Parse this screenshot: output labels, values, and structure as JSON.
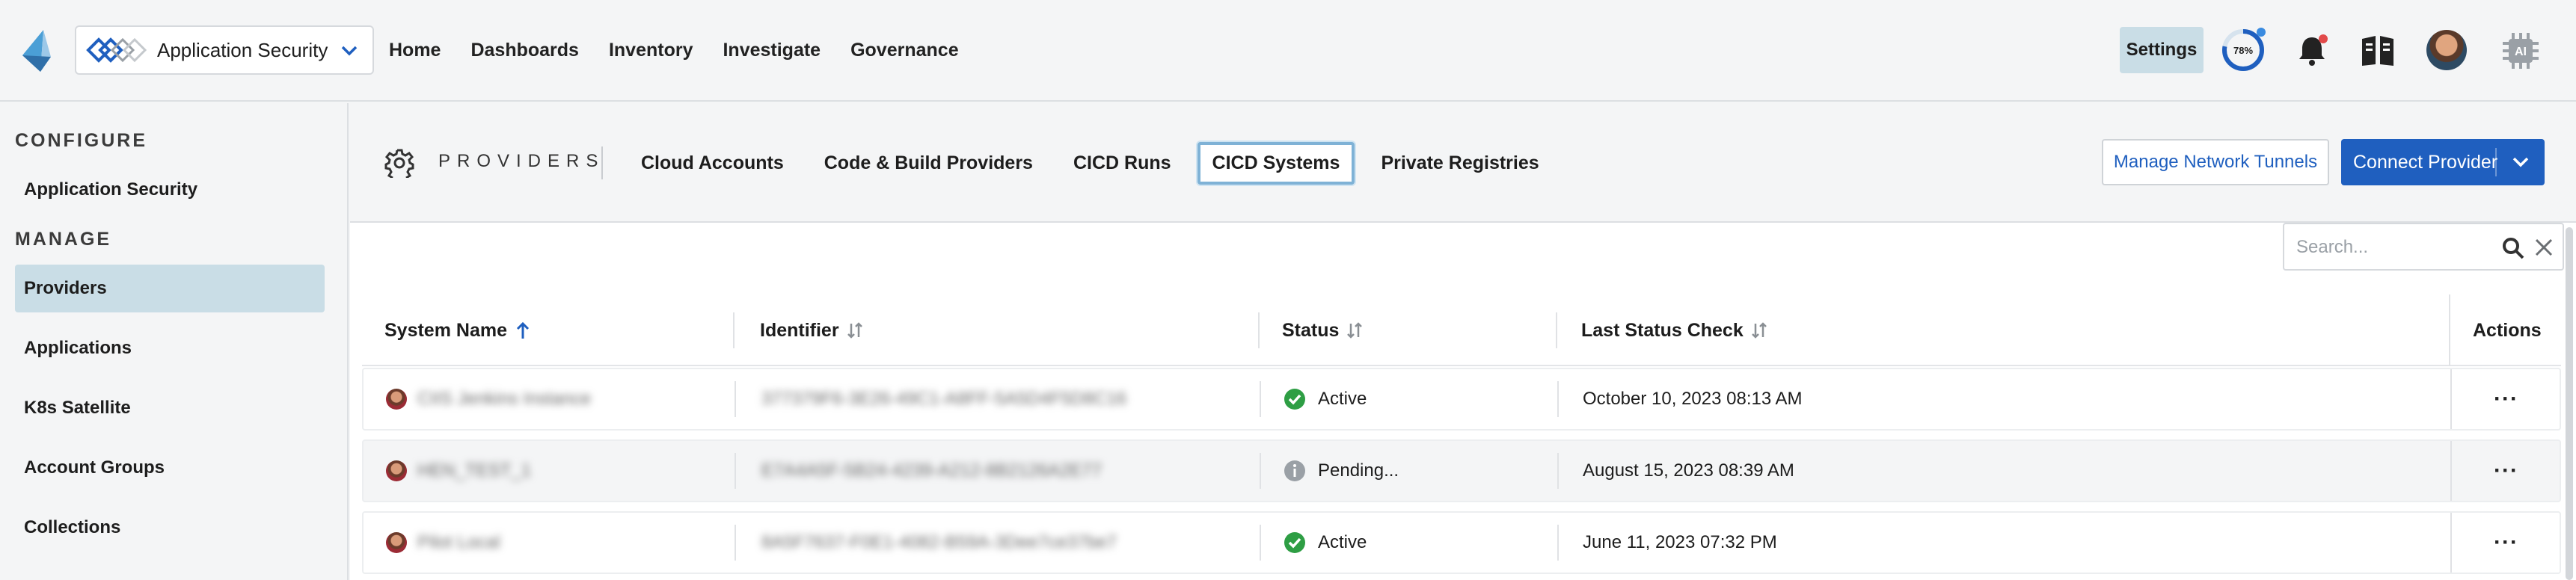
{
  "header": {
    "app_selector": "Application Security",
    "nav": [
      "Home",
      "Dashboards",
      "Inventory",
      "Investigate",
      "Governance"
    ],
    "settings_label": "Settings",
    "progress_label": "78%",
    "progress_value": 0.78
  },
  "sidebar": {
    "configure_heading": "CONFIGURE",
    "configure_items": [
      "Application Security"
    ],
    "manage_heading": "MANAGE",
    "manage_items": [
      "Providers",
      "Applications",
      "K8s Satellite",
      "Account Groups",
      "Collections"
    ],
    "active_item": "Providers"
  },
  "providers": {
    "title": "PROVIDERS",
    "tabs": [
      "Cloud Accounts",
      "Code & Build Providers",
      "CICD Runs",
      "CICD Systems",
      "Private Registries"
    ],
    "active_tab": "CICD Systems",
    "manage_tunnels_label": "Manage Network Tunnels",
    "connect_label": "Connect Provider"
  },
  "search": {
    "placeholder": "Search..."
  },
  "table": {
    "headers": {
      "system_name": "System Name",
      "identifier": "Identifier",
      "status": "Status",
      "last_status_check": "Last Status Check",
      "actions": "Actions"
    },
    "rows": [
      {
        "name": "CIIS Jenkins Instance",
        "identifier": "377379F6-3E26-49C1-A8FF-5A5D4F5D8C16",
        "status": "Active",
        "status_kind": "active",
        "last_check": "October 10, 2023 08:13 AM",
        "actions": "···"
      },
      {
        "name": "HEN_TEST_1",
        "identifier": "E7A4A5F-5B24-4239-A212-8B2126A2E77",
        "status": "Pending...",
        "status_kind": "pending",
        "last_check": "August 15, 2023 08:39 AM",
        "actions": "···"
      },
      {
        "name": "Pilot Local",
        "identifier": "8A5F7637-F0E1-4082-B59A-3Dee7ce37be7",
        "status": "Active",
        "status_kind": "active",
        "last_check": "June 11, 2023 07:32 PM",
        "actions": "···"
      }
    ]
  },
  "colors": {
    "accent": "#1f5fbf",
    "active_bg": "#c9dde6",
    "success": "#2e9e44",
    "pending": "#9aa0a6",
    "notification": "#e24a4a"
  }
}
